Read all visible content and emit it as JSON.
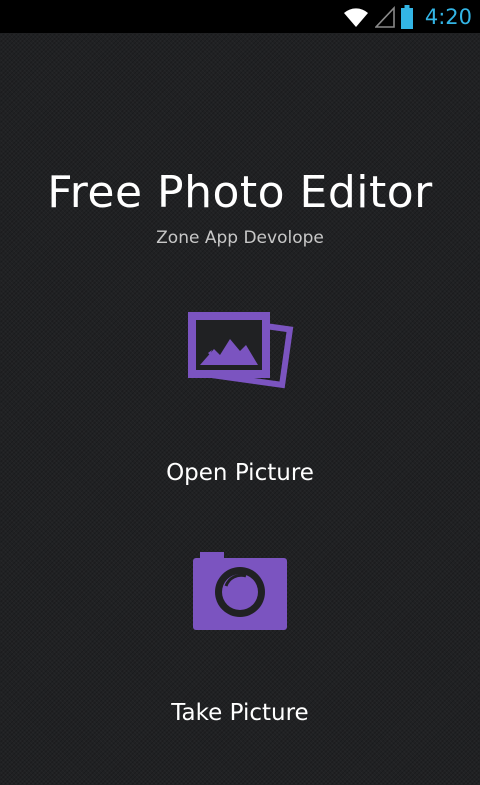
{
  "status_bar": {
    "time": "4:20",
    "icons": [
      "wifi-icon",
      "signal-icon",
      "battery-icon"
    ],
    "clock_color": "#33b5e5"
  },
  "app": {
    "title": "Free Photo Editor",
    "subtitle": "Zone App Devolope"
  },
  "actions": [
    {
      "label": "Open Picture",
      "icon": "gallery-icon"
    },
    {
      "label": "Take Picture",
      "icon": "camera-icon"
    }
  ],
  "colors": {
    "background": "#202123",
    "accent": "#7b54c0",
    "text": "#ffffff"
  }
}
